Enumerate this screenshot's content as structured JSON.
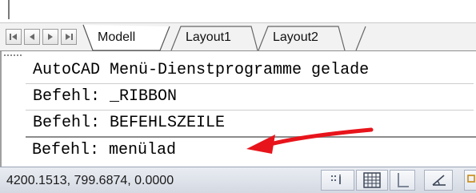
{
  "tabs": [
    {
      "label": "Modell",
      "active": true
    },
    {
      "label": "Layout1",
      "active": false
    },
    {
      "label": "Layout2",
      "active": false
    }
  ],
  "tab_navigation": [
    "first-tab-icon",
    "previous-tab-icon",
    "next-tab-icon",
    "last-tab-icon"
  ],
  "command_history": [
    "AutoCAD Menü-Dienstprogramme gelade",
    "Befehl: _RIBBON",
    "Befehl: BEFEHLSZEILE"
  ],
  "command_prompt": "Befehl: menülad",
  "annotation": {
    "type": "red-arrow",
    "color": "#e8141b"
  },
  "status_bar": {
    "coordinates": "4200.1513, 799.6874, 0.0000",
    "buttons": [
      "infer-constraints-icon",
      "grid-icon",
      "ortho-icon",
      "polar-tracking-icon",
      "object-snap-icon"
    ]
  }
}
